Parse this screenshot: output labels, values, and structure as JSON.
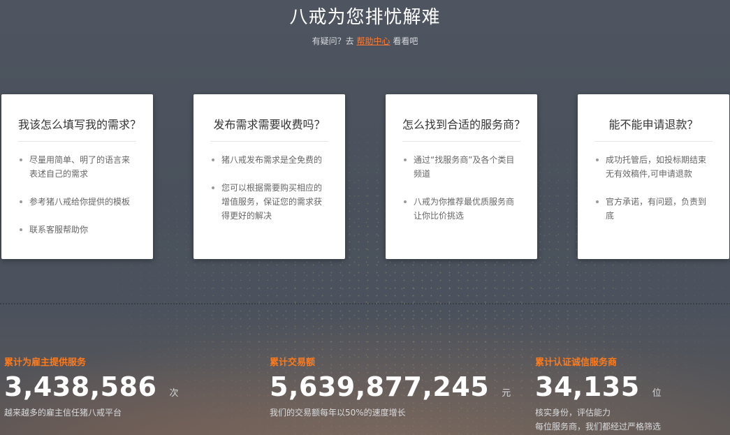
{
  "header": {
    "title": "八戒为您排忧解难",
    "subtitle_prefix": "有疑问？去",
    "help_link": "帮助中心",
    "subtitle_suffix": "看看吧"
  },
  "cards": [
    {
      "title": "我该怎么填写我的需求？",
      "items": [
        "尽量用简单、明了的语言来表述自己的需求",
        "参考猪八戒给你提供的模板",
        "联系客服帮助你"
      ]
    },
    {
      "title": "发布需求需要收费吗？",
      "items": [
        "猪八戒发布需求是全免费的",
        "您可以根据需要购买相应的增值服务，保证您的需求获得更好的解决"
      ]
    },
    {
      "title": "怎么找到合适的服务商？",
      "items": [
        "通过“找服务商”及各个类目频道",
        "八戒为你推荐最优质服务商让你比价挑选"
      ]
    },
    {
      "title": "能不能申请退款？",
      "items": [
        "成功托管后，如投标期结束无有效稿件,可申请退款",
        "官方承诺，有问题，负责到底"
      ]
    }
  ],
  "stats": [
    {
      "label": "累计为雇主提供服务",
      "value": "3,438,586",
      "unit": "次",
      "desc": [
        "越来越多的雇主信任猪八戒平台"
      ]
    },
    {
      "label": "累计交易额",
      "value": "5,639,877,245",
      "unit": "元",
      "desc": [
        "我们的交易额每年以50%的速度增长"
      ]
    },
    {
      "label": "累计认证诚信服务商",
      "value": "34,135",
      "unit": "位",
      "desc": [
        "核实身份，评估能力",
        "每位服务商，我们都经过严格筛选"
      ]
    }
  ],
  "colors": {
    "accent": "#ff7a1a",
    "link": "#ff7a2f",
    "background": "#4b525d"
  }
}
